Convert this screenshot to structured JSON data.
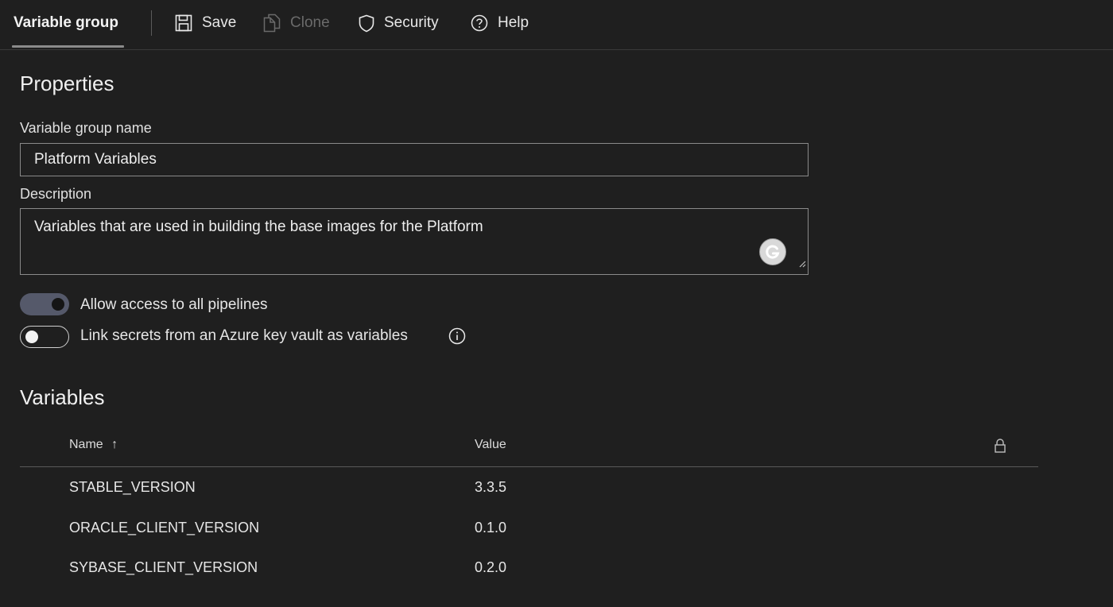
{
  "header": {
    "tab_title": "Variable group",
    "toolbar": {
      "save_label": "Save",
      "clone_label": "Clone",
      "security_label": "Security",
      "help_label": "Help"
    }
  },
  "properties": {
    "title": "Properties",
    "name_label": "Variable group name",
    "name_value": "Platform Variables",
    "description_label": "Description",
    "description_value": "Variables that are used in building the base images for the Platform",
    "toggles": [
      {
        "label": "Allow access to all pipelines",
        "state": "on"
      },
      {
        "label": "Link secrets from an Azure key vault as variables",
        "state": "off"
      }
    ]
  },
  "variables": {
    "title": "Variables",
    "columns": {
      "name": "Name",
      "name_sort_indicator": "↑",
      "value": "Value"
    },
    "rows": [
      {
        "name": "STABLE_VERSION",
        "value": "3.3.5"
      },
      {
        "name": "ORACLE_CLIENT_VERSION",
        "value": "0.1.0"
      },
      {
        "name": "SYBASE_CLIENT_VERSION",
        "value": "0.2.0"
      }
    ]
  },
  "icons": {
    "save": "save-icon",
    "clone": "clone-icon",
    "security": "shield-icon",
    "help": "help-circle-icon",
    "grammarly": "grammarly-icon",
    "info": "info-icon",
    "lock": "lock-icon"
  },
  "colors": {
    "background": "#1f1f1f",
    "toggle_on": "#55596a",
    "disabled_text": "#6a6a6a"
  }
}
